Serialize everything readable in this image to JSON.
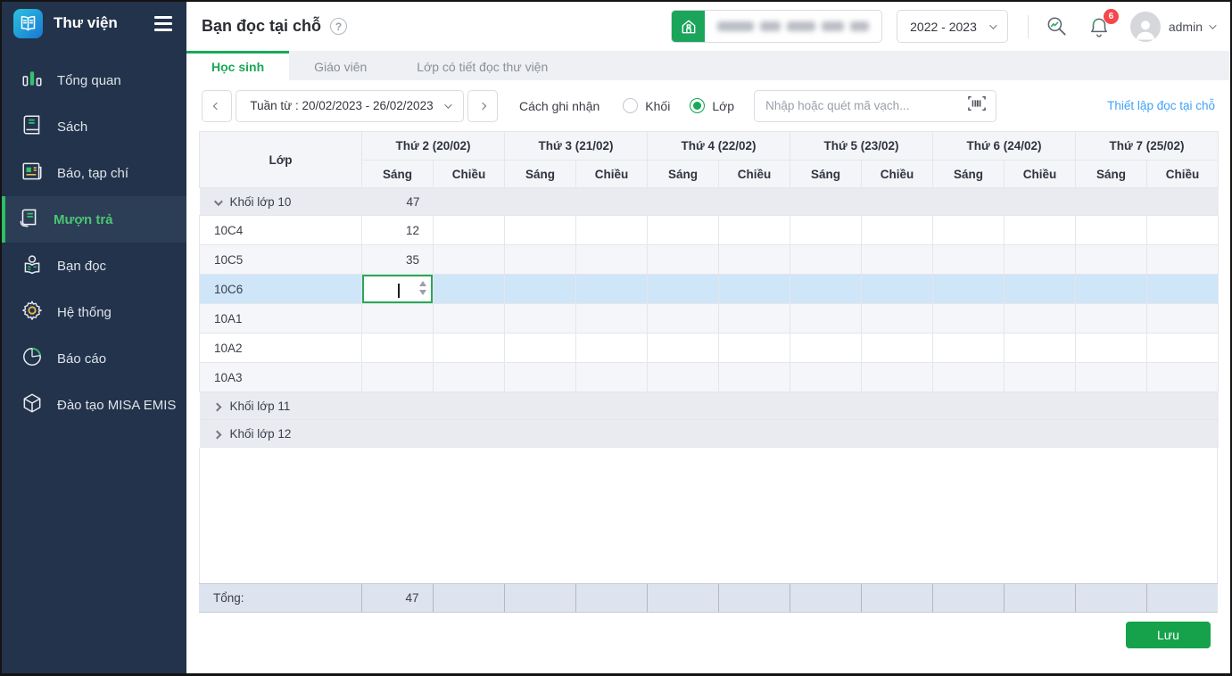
{
  "sidebar": {
    "app_title": "Thư viện",
    "items": [
      {
        "label": "Tổng quan",
        "icon": "bar-chart",
        "active": false
      },
      {
        "label": "Sách",
        "icon": "book",
        "active": false
      },
      {
        "label": "Báo, tạp chí",
        "icon": "newspaper",
        "active": false
      },
      {
        "label": "Mượn trả",
        "icon": "borrow-return",
        "active": true
      },
      {
        "label": "Bạn đọc",
        "icon": "reader",
        "active": false
      },
      {
        "label": "Hệ thống",
        "icon": "gear",
        "active": false
      },
      {
        "label": "Báo cáo",
        "icon": "pie-chart",
        "active": false
      },
      {
        "label": "Đào tạo MISA EMIS",
        "icon": "cube",
        "active": false
      }
    ]
  },
  "topbar": {
    "page_title": "Bạn đọc tại chỗ",
    "school_year": "2022 - 2023",
    "notification_count": "6",
    "username": "admin"
  },
  "tabs": [
    {
      "label": "Học sinh",
      "active": true
    },
    {
      "label": "Giáo viên",
      "active": false
    },
    {
      "label": "Lớp có tiết đọc thư viện",
      "active": false
    }
  ],
  "toolbar": {
    "week_selector": "Tuần từ : 20/02/2023 - 26/02/2023",
    "record_mode_label": "Cách ghi nhận",
    "radio_options": [
      {
        "label": "Khối",
        "selected": false
      },
      {
        "label": "Lớp",
        "selected": true
      }
    ],
    "search_placeholder": "Nhập hoặc quét mã vạch...",
    "settings_link": "Thiết lập đọc tại chỗ"
  },
  "table": {
    "class_column_header": "Lớp",
    "day_headers": [
      "Thứ 2 (20/02)",
      "Thứ 3 (21/02)",
      "Thứ 4 (22/02)",
      "Thứ 5 (23/02)",
      "Thứ 6 (24/02)",
      "Thứ 7 (25/02)"
    ],
    "session_headers": [
      "Sáng",
      "Chiều"
    ],
    "rows": [
      {
        "type": "group",
        "label": "Khối lớp 10",
        "expanded": true,
        "values": {
          "0": "47"
        }
      },
      {
        "type": "data",
        "label": "10C4",
        "values": {
          "0": "12"
        }
      },
      {
        "type": "data",
        "label": "10C5",
        "values": {
          "0": "35"
        }
      },
      {
        "type": "data",
        "label": "10C6",
        "selected": true,
        "editing_cell": 0,
        "values": {}
      },
      {
        "type": "data",
        "label": "10A1",
        "values": {}
      },
      {
        "type": "data",
        "label": "10A2",
        "values": {}
      },
      {
        "type": "data",
        "label": "10A3",
        "values": {}
      },
      {
        "type": "group",
        "label": "Khối lớp 11",
        "expanded": false,
        "values": {}
      },
      {
        "type": "group",
        "label": "Khối lớp 12",
        "expanded": false,
        "values": {}
      }
    ],
    "footer": {
      "label": "Tổng:",
      "values": {
        "0": "47"
      }
    }
  },
  "footer": {
    "save_label": "Lưu"
  },
  "colors": {
    "accent_green": "#18a957",
    "button_green": "#16a24b",
    "home_green": "#1aa55b",
    "link_blue": "#3fa2f7",
    "badge_red": "#f5484d",
    "selected_row_blue": "#cfe5f8",
    "sidebar_bg": "#22334b"
  }
}
